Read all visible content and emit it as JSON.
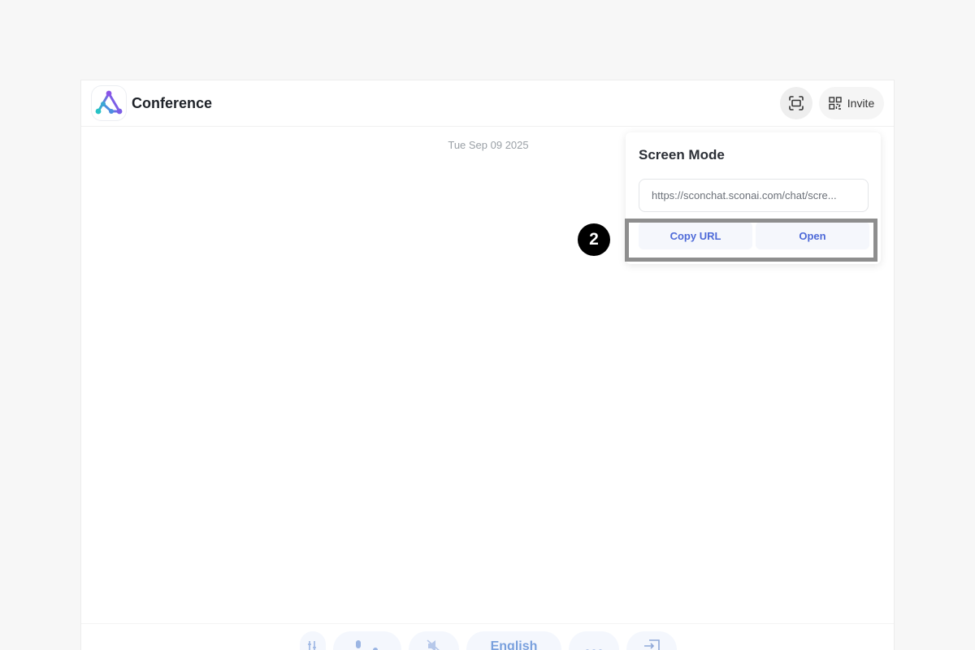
{
  "header": {
    "app_title": "Conference",
    "logo_icon": "network-triangle-logo",
    "screen_mode_icon": "screen-mode-icon",
    "invite_icon": "qr-code-icon",
    "invite_label": "Invite"
  },
  "chat": {
    "date": "Tue Sep 09 2025"
  },
  "screen_mode_popover": {
    "title": "Screen Mode",
    "url_value": "https://sconchat.sconai.com/chat/scre...",
    "copy_label": "Copy URL",
    "open_label": "Open"
  },
  "annotation": {
    "step_number": "2",
    "highlight_color": "#8e8e8e"
  },
  "bottom_toolbar": {
    "language_label": "English",
    "icons": [
      "equalizer-icon",
      "mic-off-icon",
      "speaker-off-icon",
      "more-icon",
      "exit-icon"
    ]
  },
  "colors": {
    "accent": "#4e6ad8",
    "background": "#f7f7f7"
  }
}
